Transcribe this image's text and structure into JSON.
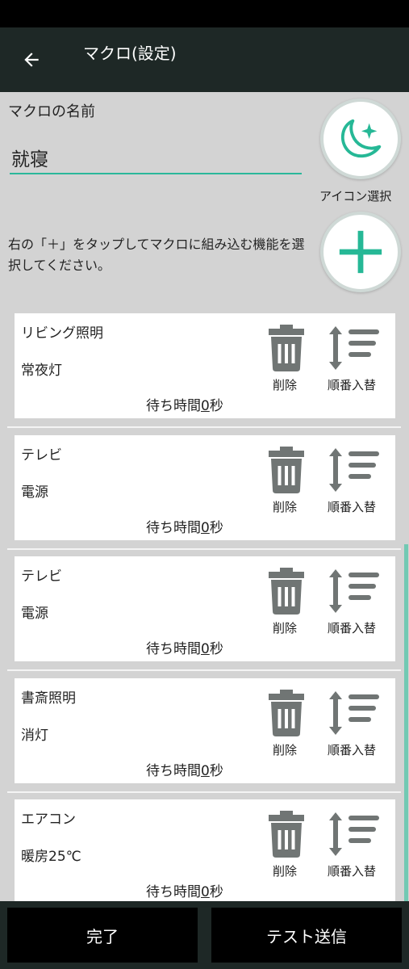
{
  "header": {
    "title": "マクロ(設定)",
    "back_icon": "arrow-left-icon"
  },
  "form": {
    "name_label": "マクロの名前",
    "name_value": "就寝",
    "icon_select_label": "アイコン選択",
    "icon_select_icon": "moon-stars-icon",
    "instruction": "右の「＋」をタップしてマクロに組み込む機能を選択してください。",
    "add_icon": "plus-icon"
  },
  "colors": {
    "accent": "#26b896",
    "app_bar": "#1e2826",
    "background": "#d3d3d3",
    "icon_gray": "#707574"
  },
  "actions": [
    {
      "device": "リビング照明",
      "function": "常夜灯",
      "wait_prefix": "待ち時間",
      "wait_value": "0",
      "wait_unit": "秒",
      "delete_label": "削除",
      "reorder_label": "順番入替"
    },
    {
      "device": "テレビ",
      "function": "電源",
      "wait_prefix": "待ち時間",
      "wait_value": "0",
      "wait_unit": "秒",
      "delete_label": "削除",
      "reorder_label": "順番入替"
    },
    {
      "device": "テレビ",
      "function": "電源",
      "wait_prefix": "待ち時間",
      "wait_value": "0",
      "wait_unit": "秒",
      "delete_label": "削除",
      "reorder_label": "順番入替"
    },
    {
      "device": "書斎照明",
      "function": "消灯",
      "wait_prefix": "待ち時間",
      "wait_value": "0",
      "wait_unit": "秒",
      "delete_label": "削除",
      "reorder_label": "順番入替"
    },
    {
      "device": "エアコン",
      "function": "暖房25℃",
      "wait_prefix": "待ち時間",
      "wait_value": "0",
      "wait_unit": "秒",
      "delete_label": "削除",
      "reorder_label": "順番入替"
    }
  ],
  "footer": {
    "done_label": "完了",
    "test_label": "テスト送信"
  }
}
